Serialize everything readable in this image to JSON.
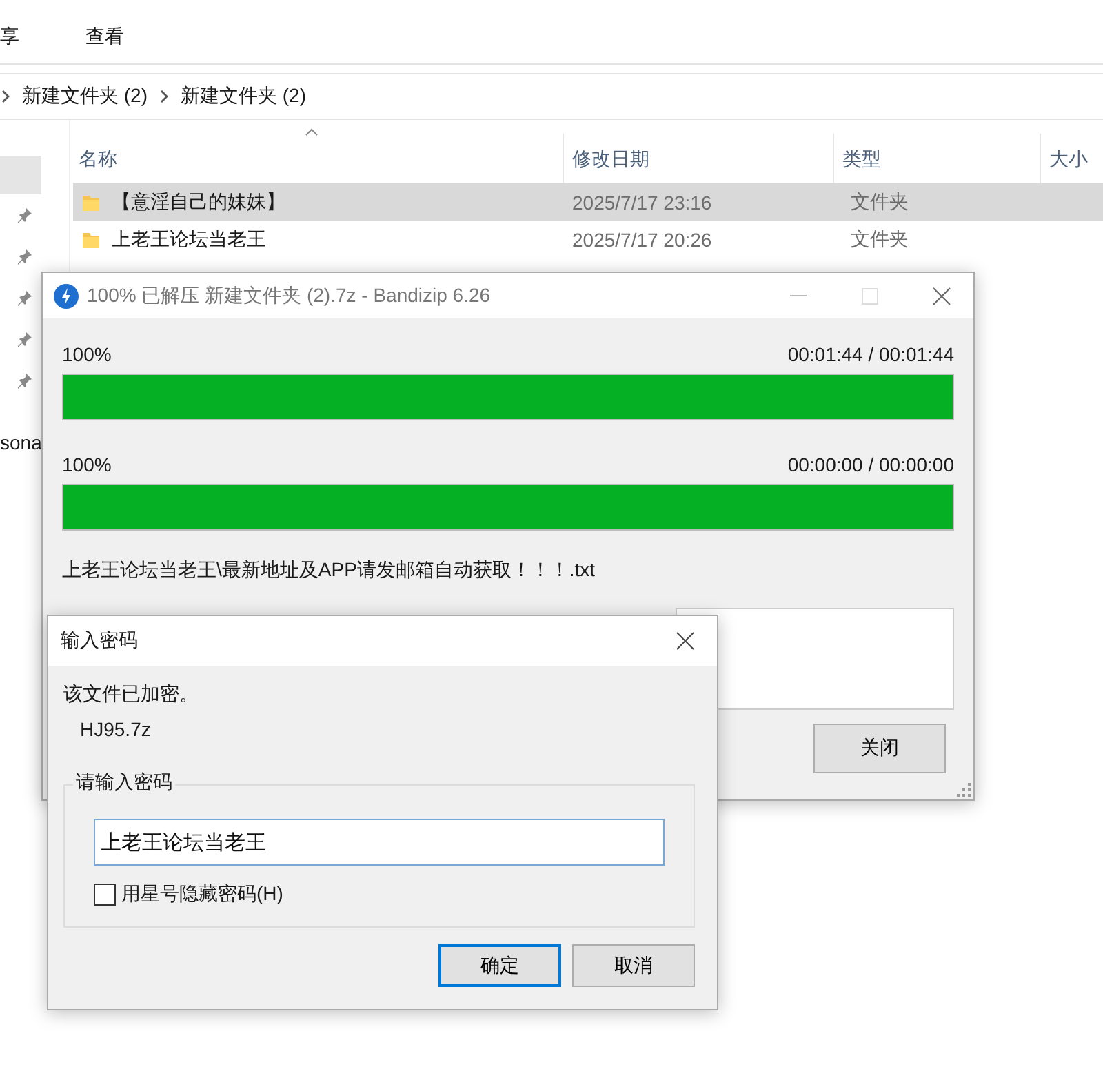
{
  "explorer": {
    "ribbon_tabs": [
      "享",
      "查看"
    ],
    "breadcrumb": [
      "新建文件夹 (2)",
      "新建文件夹 (2)"
    ],
    "nav_item": "sona",
    "columns": [
      "名称",
      "修改日期",
      "类型",
      "大小"
    ],
    "rows": [
      {
        "name": "【意淫自己的妹妹】",
        "date": "2025/7/17 23:16",
        "type": "文件夹",
        "selected": true
      },
      {
        "name": "上老王论坛当老王",
        "date": "2025/7/17 20:26",
        "type": "文件夹",
        "selected": false
      }
    ]
  },
  "bandizip": {
    "title": "100% 已解压 新建文件夹 (2).7z - Bandizip 6.26",
    "progress": [
      {
        "percent": "100%",
        "time": "00:01:44 / 00:01:44",
        "level": 1
      },
      {
        "percent": "100%",
        "time": "00:00:00 / 00:00:00",
        "level": 1
      }
    ],
    "current_file": "上老王论坛当老王\\最新地址及APP请发邮箱自动获取！！！.txt",
    "close_button": "关闭"
  },
  "password_dialog": {
    "title": "输入密码",
    "message": "该文件已加密。",
    "filename": "HJ95.7z",
    "group_label": "请输入密码",
    "password": "上老王论坛当老王",
    "hide_checkbox": {
      "label": "用星号隐藏密码(H)",
      "checked": false
    },
    "buttons": [
      {
        "label": "确定",
        "default": true
      },
      {
        "label": "取消",
        "default": false
      }
    ]
  }
}
